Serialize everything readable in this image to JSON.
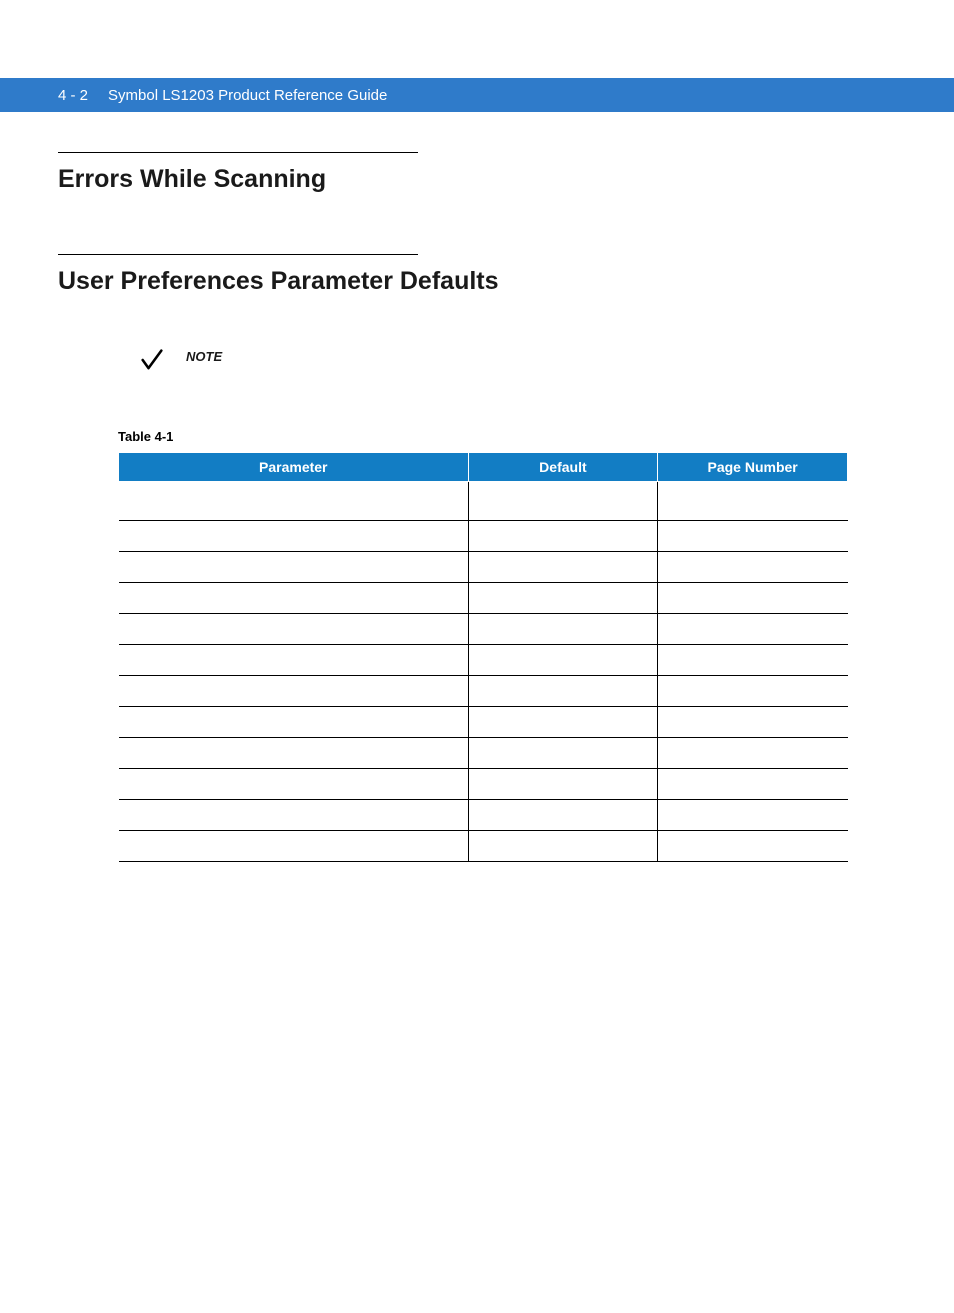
{
  "header": {
    "page_number": "4 - 2",
    "title": "Symbol LS1203 Product Reference Guide"
  },
  "sections": {
    "h1": "Errors While Scanning",
    "h2": "User Preferences Parameter Defaults"
  },
  "note": {
    "label": "NOTE"
  },
  "table": {
    "caption": "Table 4-1",
    "columns": [
      "Parameter",
      "Default",
      "Page Number"
    ],
    "rows": [
      [
        "",
        "",
        ""
      ],
      [
        "",
        "",
        ""
      ],
      [
        "",
        "",
        ""
      ],
      [
        "",
        "",
        ""
      ],
      [
        "",
        "",
        ""
      ],
      [
        "",
        "",
        ""
      ],
      [
        "",
        "",
        ""
      ],
      [
        "",
        "",
        ""
      ],
      [
        "",
        "",
        ""
      ],
      [
        "",
        "",
        ""
      ],
      [
        "",
        "",
        ""
      ],
      [
        "",
        "",
        ""
      ]
    ]
  }
}
